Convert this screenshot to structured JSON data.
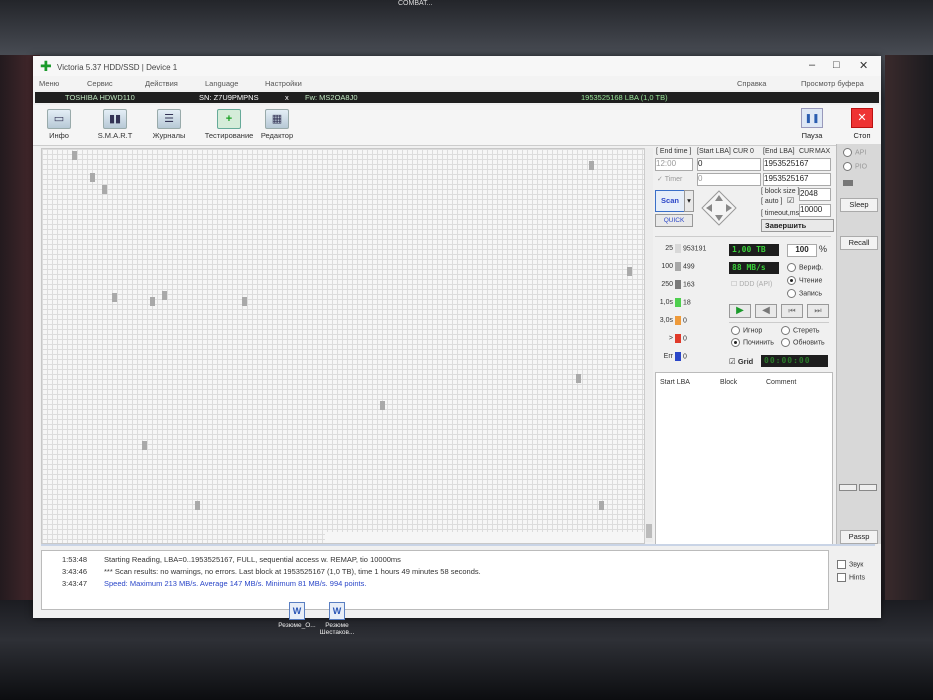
{
  "desktop": {
    "top_caption": "COMBAT...",
    "icons": [
      {
        "label": "Резюме_О..."
      },
      {
        "label": "Резюме Шестаков..."
      }
    ]
  },
  "window": {
    "title": "Victoria 5.37 HDD/SSD | Device 1",
    "menu": [
      "Меню",
      "Сервис",
      "Действия",
      "Language",
      "Настройки"
    ],
    "menu_right": [
      "Справка",
      "Просмотр буфера"
    ],
    "info": {
      "model": "TOSHIBA HDWD110",
      "serial": "SN: Z7U9PMPNS",
      "close_mark": "x",
      "firmware": "Fw: MS2OA8J0",
      "lba": "1953525168 LBA (1,0 TB)"
    },
    "toolbar": {
      "buttons": [
        {
          "label": "Инфо",
          "icon": "info-icon"
        },
        {
          "label": "S.M.A.R.T",
          "icon": "smart-icon"
        },
        {
          "label": "Журналы",
          "icon": "journal-icon"
        },
        {
          "label": "Тестирование",
          "icon": "test-icon"
        },
        {
          "label": "Редактор",
          "icon": "editor-icon"
        }
      ],
      "pause": "Пауза",
      "stop": "Стоп"
    },
    "controls": {
      "end_time_label": "[ End time ]",
      "start_lba_label": "[Start LBA]",
      "cur_label": "CUR",
      "cur_value": "0",
      "end_lba_label": "[End LBA]",
      "cur2_label": "CUR",
      "max_label": "MAX",
      "end_time": "12:00",
      "start_lba": "0",
      "end_lba": "1953525167",
      "timer_label": "Timer",
      "timer_value": "0",
      "end_lba_2": "1953525167",
      "block_size_label": "[ block size ]",
      "auto_label": "[ auto ]",
      "block_size": "2048",
      "timeout_label": "[ timeout,ms ]",
      "timeout": "10000",
      "scan_label": "Scan",
      "quick_label": "QUICK",
      "finish_label": "Завершить",
      "capacity_lcd": "1,00 TB",
      "percent": "100",
      "percent_unit": "%",
      "speed_lcd": "88 MB/s",
      "ddd_label": "DDD (API)",
      "mode_radios": [
        {
          "label": "Вериф.",
          "on": false
        },
        {
          "label": "Чтение",
          "on": true
        },
        {
          "label": "Запись",
          "on": false
        }
      ],
      "action_radios": [
        {
          "label": "Игнор",
          "on": false
        },
        {
          "label": "Стереть",
          "on": false
        },
        {
          "label": "Починить",
          "on": true
        },
        {
          "label": "Обновить",
          "on": false
        }
      ],
      "grid_label": "Grid",
      "grid_timer": "00:00:00",
      "legend": [
        {
          "label": "25",
          "count": "953191",
          "color": "#d8d8d8"
        },
        {
          "label": "100",
          "count": "499",
          "color": "#a8a8a8"
        },
        {
          "label": "250",
          "count": "163",
          "color": "#7a7a7a"
        },
        {
          "label": "1,0s",
          "count": "18",
          "color": "#4fcf4f"
        },
        {
          "label": "3,0s",
          "count": "0",
          "color": "#ee9a3a"
        },
        {
          "label": ">",
          "count": "0",
          "color": "#e03a2a"
        },
        {
          "label": "Err",
          "count": "0",
          "color": "#2a46c8"
        }
      ]
    },
    "results_header": {
      "start_lba": "Start LBA",
      "block": "Block",
      "comment": "Comment"
    },
    "side_buttons": {
      "api": "API",
      "pio": "PIO",
      "sleep": "Sleep",
      "recall": "Recall",
      "passp": "Passp"
    },
    "log": [
      {
        "time": "1:53:48",
        "msg": "Starting Reading, LBA=0..1953525167, FULL, sequential access w. REMAP, tio 10000ms",
        "blue": false
      },
      {
        "time": "3:43:46",
        "msg": "*** Scan results: no warnings, no errors. Last block at 1953525167 (1,0 TB), time 1 hours 49 minutes 58 seconds.",
        "blue": false
      },
      {
        "time": "3:43:47",
        "msg": "Speed: Maximum 213 MB/s. Average 147 MB/s. Minimum 81 MB/s. 994 points.",
        "blue": true
      }
    ],
    "log_checks": [
      {
        "label": "Звук"
      },
      {
        "label": "Hints"
      }
    ]
  },
  "colors": {
    "lcd_green": "#3ad23a",
    "accent_blue": "#2a46c8",
    "stop_red": "#e33333"
  }
}
